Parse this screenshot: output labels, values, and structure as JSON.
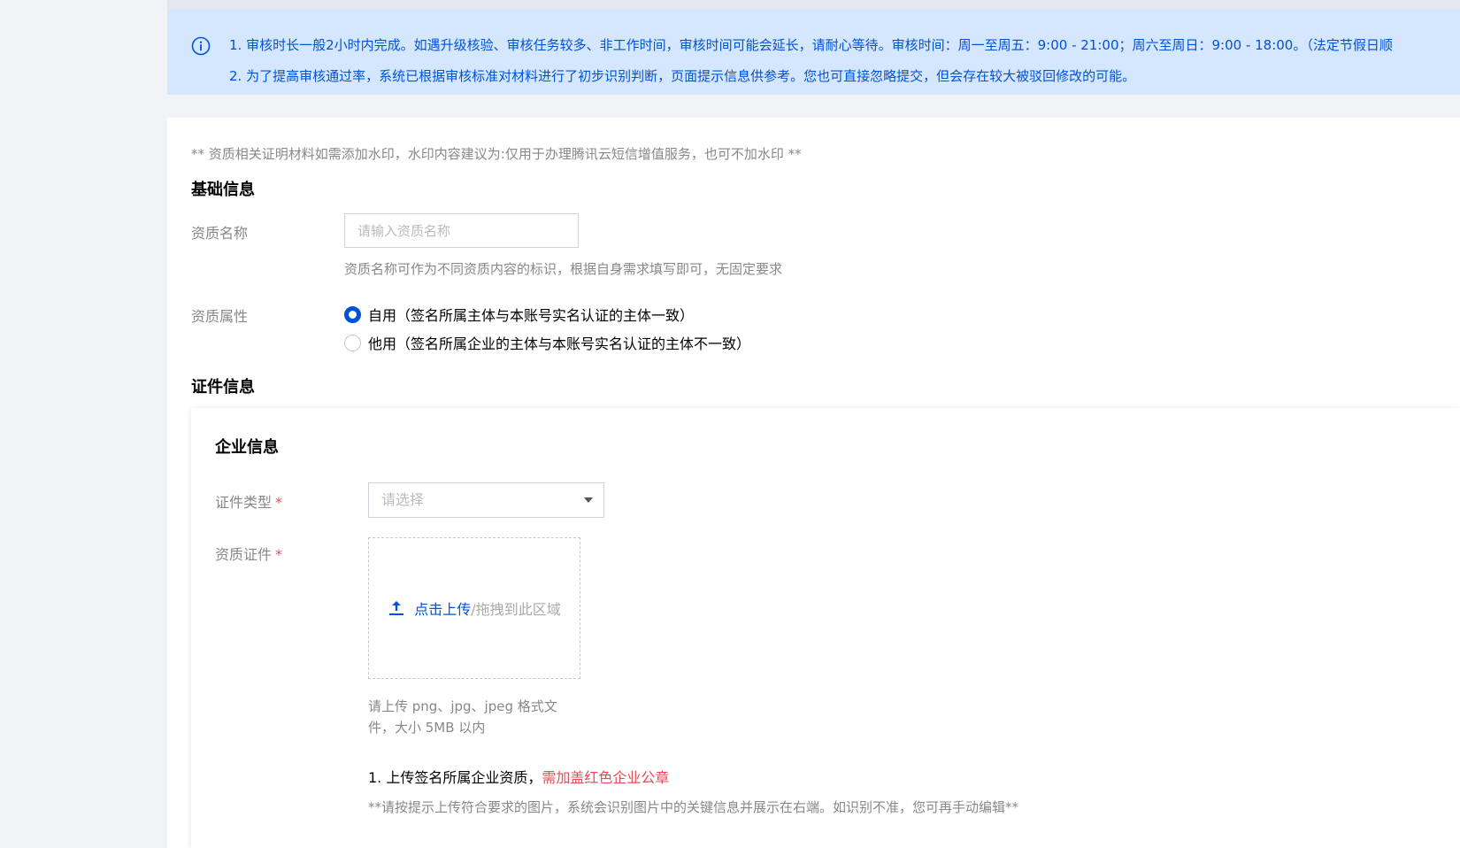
{
  "notice": {
    "line1": "1. 审核时长一般2小时内完成。如遇升级核验、审核任务较多、非工作时间，审核时间可能会延长，请耐心等待。审核时间：周一至周五：9:00 - 21:00；周六至周日：9:00 - 18:00。（法定节假日顺",
    "line2": "2. 为了提高审核通过率，系统已根据审核标准对材料进行了初步识别判断，页面提示信息供参考。您也可直接忽略提交，但会存在较大被驳回修改的可能。",
    "icon": "info-icon"
  },
  "form": {
    "watermark_hint": "** 资质相关证明材料如需添加水印，水印内容建议为:仅用于办理腾讯云短信增值服务，也可不加水印 **",
    "basic_section": "基础信息",
    "qual_name_label": "资质名称",
    "qual_name_placeholder": "请输入资质名称",
    "qual_name_value": "",
    "qual_name_help": "资质名称可作为不同资质内容的标识，根据自身需求填写即可，无固定要求",
    "qual_attr_label": "资质属性",
    "radio_self": "自用（签名所属主体与本账号实名认证的主体一致）",
    "radio_other": "他用（签名所属企业的主体与本账号实名认证的主体不一致）",
    "selected_attr": "self",
    "cert_section": "证件信息"
  },
  "company": {
    "title": "企业信息",
    "cert_type_label": "证件类型",
    "required_mark": "*",
    "cert_type_placeholder": "请选择",
    "qual_cert_label": "资质证件",
    "upload_link": "点击上传",
    "upload_drag": "/拖拽到此区域",
    "upload_tip": "请上传 png、jpg、jpeg 格式文件，大小 5MB 以内",
    "req_prefix": "1. 上传签名所属企业资质，",
    "req_red": "需加盖红色企业公章",
    "ocr_hint": "**请按提示上传符合要求的图片，系统会识别图片中的关键信息并展示在右端。如识别不准，您可再手动编辑**"
  },
  "colors": {
    "primary": "#0052d9",
    "notice_bg": "#d5e7ff",
    "danger": "#e34d59"
  }
}
